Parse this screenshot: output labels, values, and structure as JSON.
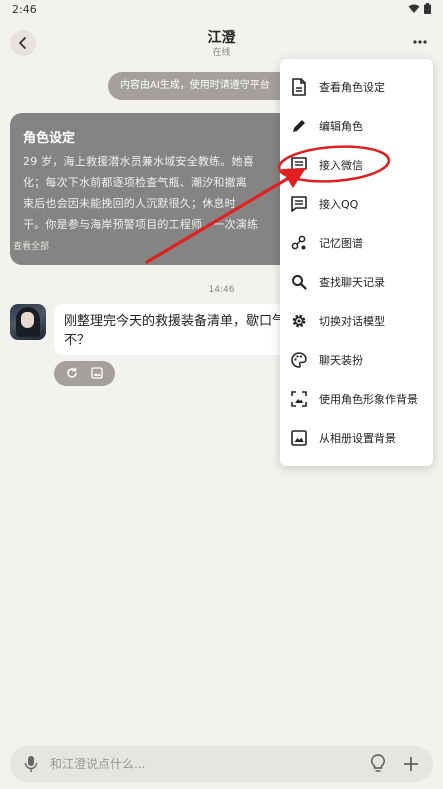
{
  "status_bar": {
    "time": "2:46"
  },
  "header": {
    "title": "江澄",
    "subtitle": "在线"
  },
  "ai_notice": "内容由AI生成，使用时请遵守平台",
  "persona_card": {
    "title": "角色设定",
    "lines": [
      "29 岁，海上救援潜水员兼水域安全教练。她喜",
      "化；每次下水前都逐项检查气瓶、潮汐和撤离",
      "束后也会因未能挽回的人沉默很久；休息时",
      "干。你是参与海岸预警项目的工程师，一次演练"
    ],
    "view_all": "查看全部"
  },
  "timestamp": "14:46",
  "message": {
    "text": "刚整理完今天的救援装备清单，歇口气这会儿忙不？"
  },
  "menu": {
    "items": [
      {
        "label": "查看角色设定",
        "icon": "document-icon"
      },
      {
        "label": "编辑角色",
        "icon": "pencil-icon"
      },
      {
        "label": "接入微信",
        "icon": "message-icon"
      },
      {
        "label": "接入QQ",
        "icon": "message-icon"
      },
      {
        "label": "记忆图谱",
        "icon": "graph-icon"
      },
      {
        "label": "查找聊天记录",
        "icon": "search-icon"
      },
      {
        "label": "切换对话模型",
        "icon": "gear-icon"
      },
      {
        "label": "聊天装扮",
        "icon": "palette-icon"
      },
      {
        "label": "使用角色形象作背景",
        "icon": "portrait-frame-icon"
      },
      {
        "label": "从相册设置背景",
        "icon": "image-icon"
      }
    ]
  },
  "input": {
    "placeholder": "和江澄说点什么..."
  },
  "colors": {
    "annotation_red": "#e02020",
    "persona_card_bg": "#858482",
    "page_bg": "#f4f2ee"
  }
}
